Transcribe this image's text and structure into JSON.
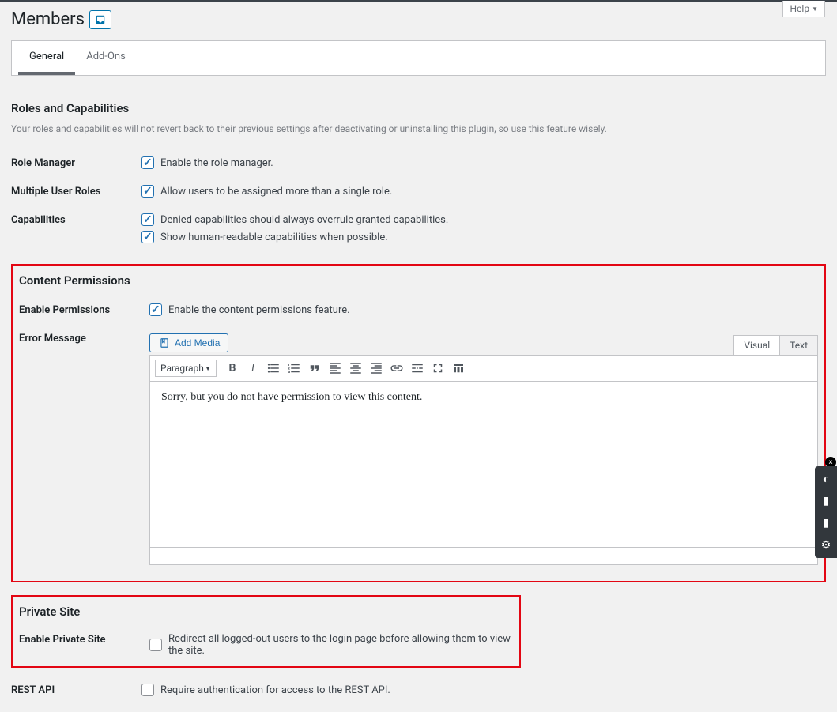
{
  "help": {
    "label": "Help"
  },
  "page": {
    "title": "Members"
  },
  "tabs": {
    "general": "General",
    "addons": "Add-Ons"
  },
  "sections": {
    "roles": {
      "title": "Roles and Capabilities",
      "desc": "Your roles and capabilities will not revert back to their previous settings after deactivating or uninstalling this plugin, so use this feature wisely.",
      "role_manager": {
        "label": "Role Manager",
        "cb1": "Enable the role manager."
      },
      "multi": {
        "label": "Multiple User Roles",
        "cb1": "Allow users to be assigned more than a single role."
      },
      "caps": {
        "label": "Capabilities",
        "cb1": "Denied capabilities should always overrule granted capabilities.",
        "cb2": "Show human-readable capabilities when possible."
      }
    },
    "content": {
      "title": "Content Permissions",
      "enable": {
        "label": "Enable Permissions",
        "cb1": "Enable the content permissions feature."
      },
      "error": {
        "label": "Error Message"
      }
    },
    "private": {
      "title": "Private Site",
      "enable": {
        "label": "Enable Private Site",
        "cb1": "Redirect all logged-out users to the login page before allowing them to view the site."
      },
      "rest": {
        "label": "REST API",
        "cb1": "Require authentication for access to the REST API."
      }
    }
  },
  "editor": {
    "add_media": "Add Media",
    "tabs": {
      "visual": "Visual",
      "text": "Text"
    },
    "format": "Paragraph",
    "content": "Sorry, but you do not have permission to view this content."
  }
}
